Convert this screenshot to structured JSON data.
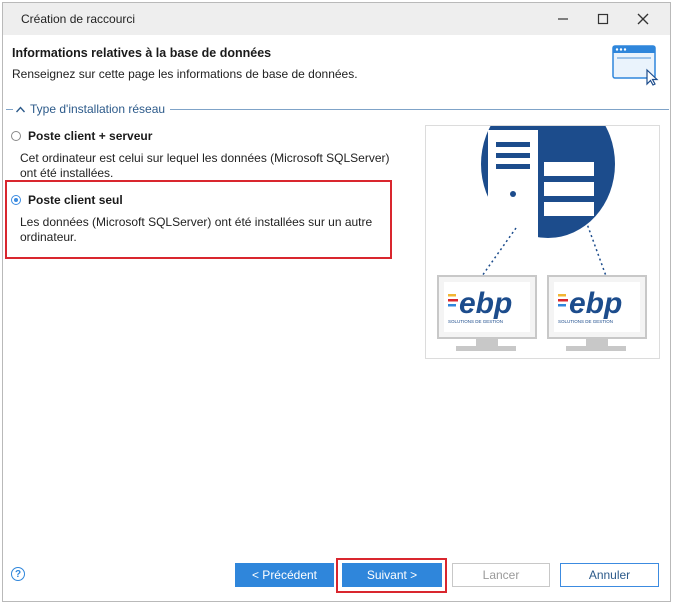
{
  "window": {
    "title": "Création de raccourci"
  },
  "header": {
    "title": "Informations relatives à la base de données",
    "subtitle": "Renseignez sur cette page les informations de base de données."
  },
  "group": {
    "label": "Type d'installation réseau"
  },
  "options": [
    {
      "label": "Poste client + serveur",
      "description": "Cet ordinateur est celui sur lequel les données (Microsoft SQLServer) ont été installées.",
      "selected": false
    },
    {
      "label": "Poste client seul",
      "description": "Les données (Microsoft SQLServer) ont été installées sur un autre ordinateur.",
      "selected": true
    }
  ],
  "illustration": {
    "brand_primary": "ebp",
    "brand_sub": "SOLUTIONS DE GESTION",
    "colors": {
      "server": "#1c4c8c",
      "brand_blue": "#1c4c8c",
      "stripe_yellow": "#f2b632",
      "stripe_red": "#d9262e",
      "stripe_blue": "#2f86db"
    }
  },
  "buttons": {
    "previous": "< Précédent",
    "next": "Suivant >",
    "cancel_disabled": "Lancer",
    "cancel": "Annuler"
  },
  "colors": {
    "accent": "#2f86db",
    "highlight": "#d9262e"
  }
}
